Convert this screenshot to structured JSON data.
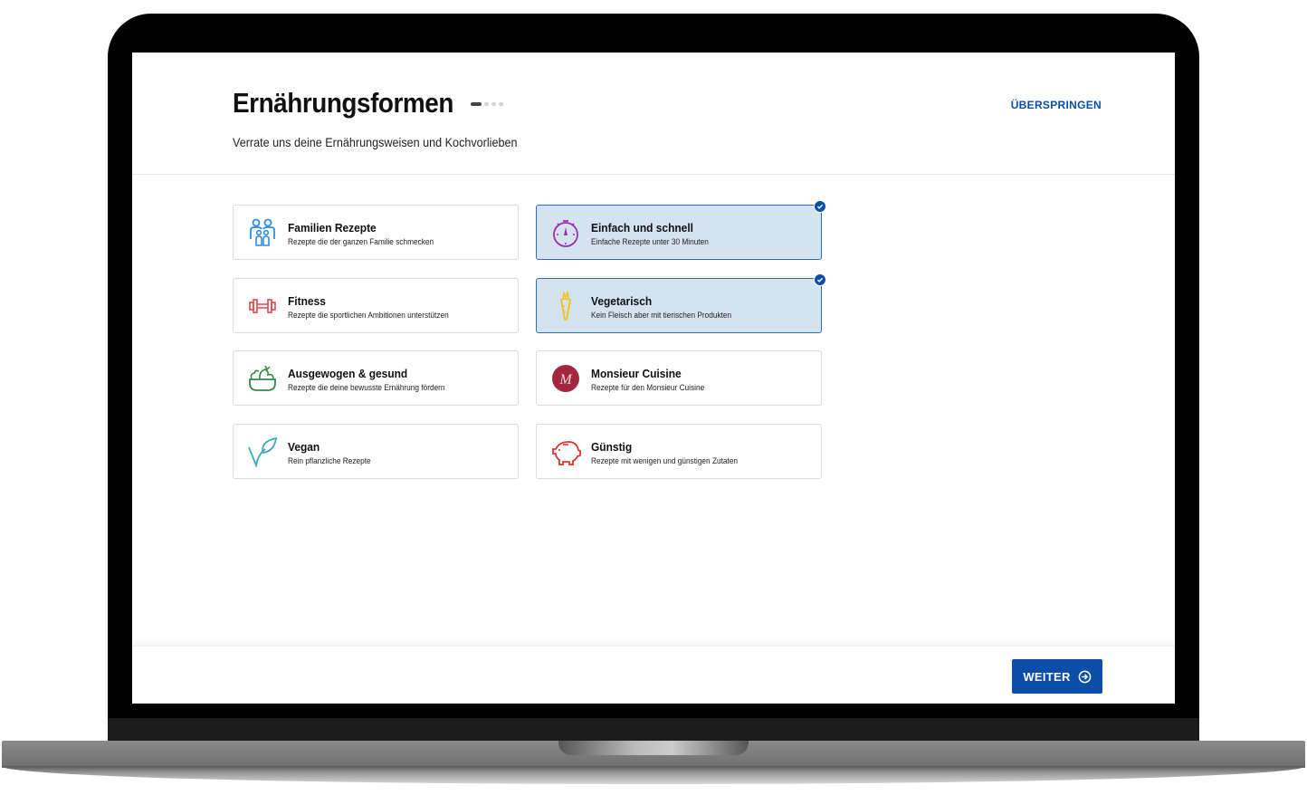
{
  "header": {
    "title": "Ernährungsformen",
    "subtitle": "Verrate uns deine Ernährungsweisen und Kochvorlieben",
    "skip_label": "ÜBERSPRINGEN",
    "progress": {
      "step": 1,
      "total": 4
    }
  },
  "options": [
    {
      "title": "Familien Rezepte",
      "desc": "Rezepte die der ganzen Familie schmecken",
      "icon": "family-icon",
      "selected": false,
      "color": "#2b8fe0"
    },
    {
      "title": "Einfach und schnell",
      "desc": "Einfache Rezepte unter 30 Minuten",
      "icon": "stopwatch-icon",
      "selected": true,
      "color": "#9b2fae"
    },
    {
      "title": "Fitness",
      "desc": "Rezepte die sportlichen Ambitionen unterstützen",
      "icon": "dumbbell-icon",
      "selected": false,
      "color": "#e8434b"
    },
    {
      "title": "Vegetarisch",
      "desc": "Kein Fleisch aber mit tierischen Produkten",
      "icon": "carrot-icon",
      "selected": true,
      "color": "#f2c21b"
    },
    {
      "title": "Ausgewogen & gesund",
      "desc": "Rezepte die deine bewusste Ernährung fördern",
      "icon": "salad-bowl-icon",
      "selected": false,
      "color": "#2e8b4a"
    },
    {
      "title": "Monsieur Cuisine",
      "desc": "Rezepte für den Monsieur Cuisine",
      "icon": "monsieur-cuisine-logo-icon",
      "selected": false,
      "color": "#a3263f"
    },
    {
      "title": "Vegan",
      "desc": "Rein pflanzliche Rezepte",
      "icon": "leaf-icon",
      "selected": false,
      "color": "#3aaab8"
    },
    {
      "title": "Günstig",
      "desc": "Rezepte mit wenigen und günstigen Zutaten",
      "icon": "piggy-bank-icon",
      "selected": false,
      "color": "#e0332f"
    }
  ],
  "footer": {
    "next_label": "WEITER"
  },
  "colors": {
    "accent": "#0a4ea8",
    "selected_bg": "#d5e2f0"
  }
}
